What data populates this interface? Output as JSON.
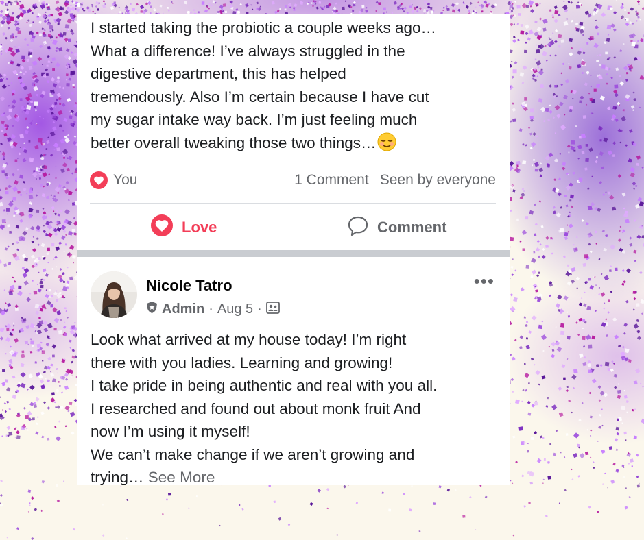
{
  "post_one": {
    "text": "I started taking the probiotic a couple weeks ago…\nWhat a difference! I’ve always struggled in the\ndigestive department, this has helped\ntremendously. Also I’m certain because I have cut\nmy sugar intake way back. I’m just feeling much\nbetter overall tweaking those two things…",
    "emoji_icon": "relieved-face-emoji",
    "reactions": {
      "reactor": "You",
      "comments_count": "1 Comment",
      "seen_by": "Seen by everyone"
    },
    "actions": {
      "love_label": "Love",
      "comment_label": "Comment"
    }
  },
  "post_two": {
    "author": "Nicole Tatro",
    "role": "Admin",
    "separator": "·",
    "date": "Aug 5",
    "more_label": "•••",
    "text": "Look what arrived at my house today! I’m right\nthere with you ladies. Learning and growing!\nI take pride in being authentic and real with you all.\nI researched and found out about monk fruit And\nnow I’m using it myself!\nWe can’t make change if we aren’t growing and\ntrying… ",
    "see_more": "See More"
  },
  "colors": {
    "love_red": "#f33e58",
    "secondary_text": "#65676b",
    "primary_text": "#1c1e21",
    "glitter_purple": "#9b3fe0"
  }
}
